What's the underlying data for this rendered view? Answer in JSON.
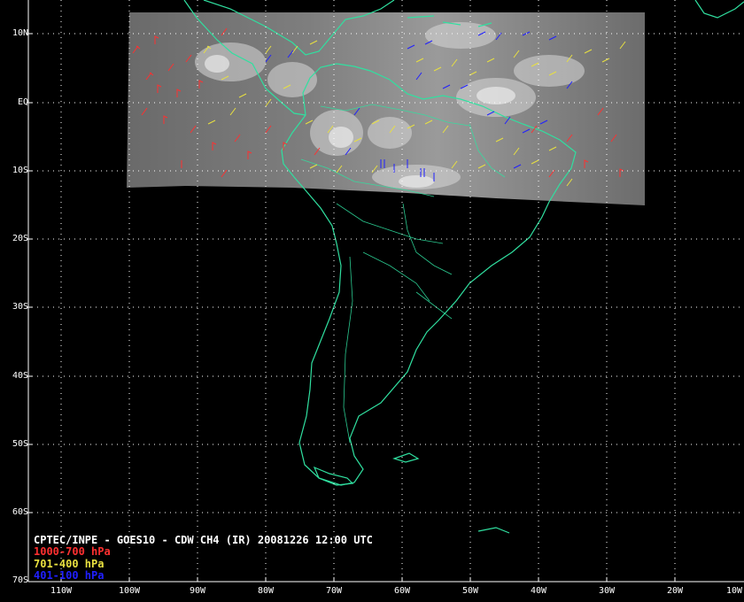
{
  "title": "CPTEC/INPE - GOES10 - CDW CH4 (IR) 20081226 12:00 UTC",
  "legend": [
    {
      "label": "1000-700 hPa",
      "color": "#ff3030"
    },
    {
      "label": "701-400 hPa",
      "color": "#e8e040"
    },
    {
      "label": "401-100 hPa",
      "color": "#2020ff"
    }
  ],
  "lat_labels": [
    "10N",
    "EQ",
    "10S",
    "20S",
    "30S",
    "40S",
    "50S",
    "60S",
    "70S"
  ],
  "lon_labels": [
    "110W",
    "100W",
    "90W",
    "80W",
    "70W",
    "60W",
    "50W",
    "40W",
    "30W",
    "20W",
    "10W"
  ],
  "colors": {
    "coastline": "#30e0a0",
    "grid": "#ffffff",
    "background": "#000000"
  }
}
